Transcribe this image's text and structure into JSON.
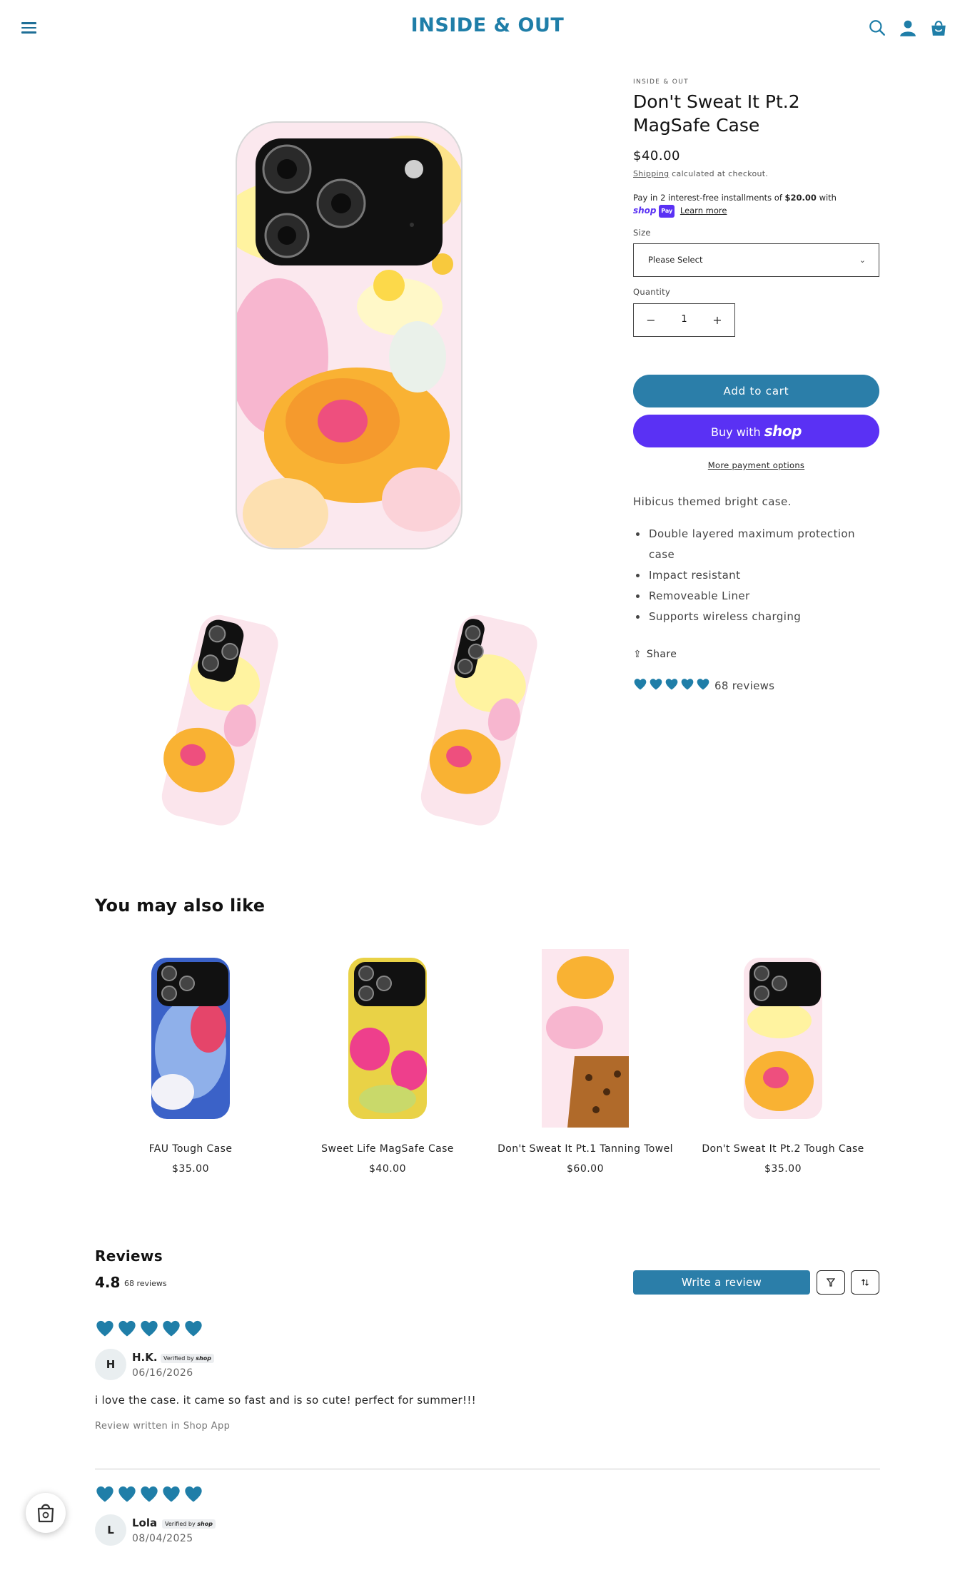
{
  "header": {
    "logo": "INSIDE & OUT"
  },
  "product": {
    "vendor": "INSIDE & OUT",
    "title": "Don't Sweat It Pt.2 MagSafe Case",
    "price": "$40.00",
    "shipping_link": "Shipping",
    "shipping_note": " calculated at checkout.",
    "installments_text": "Pay in 2 interest-free installments of ",
    "installments_amount": "$20.00",
    "installments_with": " with",
    "shop_mini": "shop",
    "shop_pay_badge": "Pay",
    "learn_more": "Learn more",
    "size_label": "Size",
    "size_value": "Please Select",
    "quantity_label": "Quantity",
    "quantity_value": "1",
    "add_to_cart": "Add to cart",
    "buy_with": "Buy with ",
    "buy_with_brand": "shop",
    "more_payment": "More payment options",
    "description": "Hibicus themed bright case.",
    "features": [
      "Double layered maximum protection case",
      "Impact resistant",
      "Removeable Liner",
      "Supports wireless charging"
    ],
    "share": "Share",
    "rating_hearts": 5,
    "reviews_count": "68 reviews"
  },
  "recommendations": {
    "title": "You may also like",
    "items": [
      {
        "name": "FAU Tough Case",
        "price": "$35.00"
      },
      {
        "name": "Sweet Life MagSafe Case",
        "price": "$40.00"
      },
      {
        "name": "Don't Sweat It Pt.1 Tanning Towel",
        "price": "$60.00"
      },
      {
        "name": "Don't Sweat It Pt.2 Tough Case",
        "price": "$35.00"
      }
    ]
  },
  "reviews": {
    "title": "Reviews",
    "average": "4.8",
    "count": "68 reviews",
    "write_button": "Write a review",
    "items": [
      {
        "initial": "H",
        "name": "H.K.",
        "verified": "Verified by",
        "verified_brand": "shop",
        "date": "06/16/2026",
        "body": "i love the case. it came so fast and is so cute! perfect for summer!!!",
        "source": "Review written in Shop App",
        "stars": 5
      },
      {
        "initial": "L",
        "name": "Lola",
        "verified": "Verified by",
        "verified_brand": "shop",
        "date": "08/04/2025",
        "stars": 5
      }
    ]
  },
  "colors": {
    "brand": "#1f7ea8",
    "button": "#2b7ea9",
    "shop_purple": "#5a31f4",
    "heart": "#1f7ea8"
  }
}
